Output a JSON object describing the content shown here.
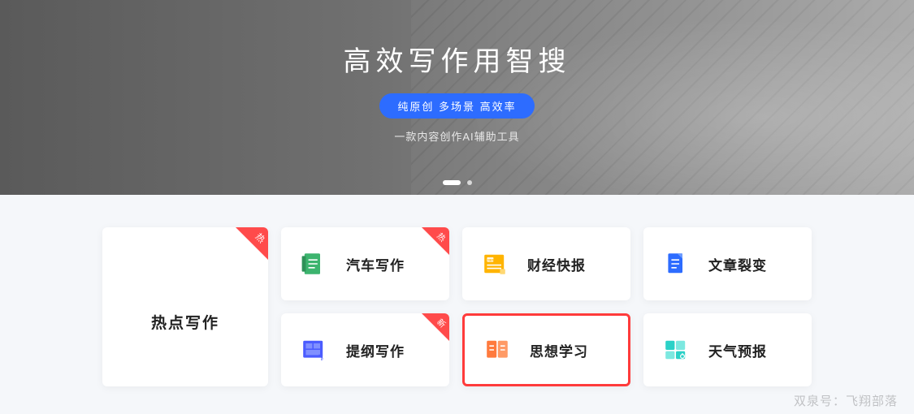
{
  "hero": {
    "title": "高效写作用智搜",
    "pill": "纯原创 多场景 高效率",
    "subtitle": "一款内容创作AI辅助工具"
  },
  "bigCard": {
    "label": "热点写作",
    "ribbon": "热"
  },
  "cards": [
    {
      "label": "汽车写作",
      "ribbon": "热",
      "iconColor": "#3cb46e"
    },
    {
      "label": "财经快报",
      "ribbon": "",
      "iconColor": "#ffb400"
    },
    {
      "label": "文章裂变",
      "ribbon": "",
      "iconColor": "#2d6cff"
    },
    {
      "label": "提纲写作",
      "ribbon": "新",
      "iconColor": "#4b5cff"
    },
    {
      "label": "思想学习",
      "ribbon": "",
      "iconColor": "#ff7a3d",
      "highlight": true
    },
    {
      "label": "天气预报",
      "ribbon": "",
      "iconColor": "#2bd1c7"
    }
  ],
  "watermark": "双泉号：飞翔部落",
  "colors": {
    "accent": "#2d6cff",
    "danger": "#ff4b4b"
  }
}
